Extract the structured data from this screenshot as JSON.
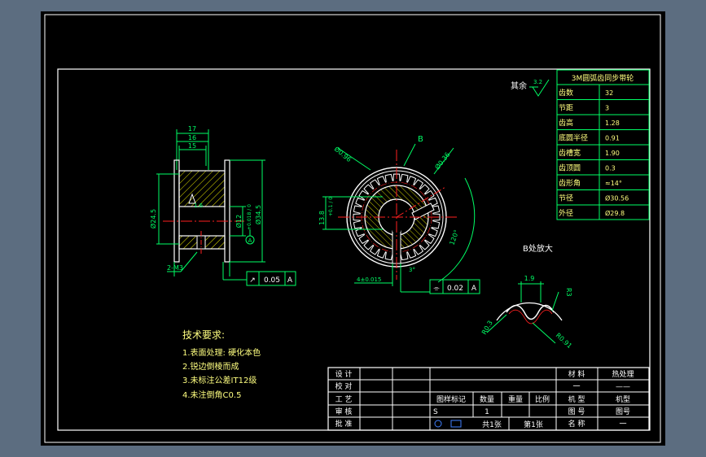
{
  "drawing": {
    "colors": {
      "background": "#000000",
      "frame": "#ffffff",
      "outline": "#ffffff",
      "dimension": "#00ff66",
      "centerline": "#ff2020",
      "hatch": "#ffff00",
      "text": "#ffffff",
      "text_yellow": "#ffff80",
      "table_border": "#00ff66",
      "table_text": "#ffff80"
    },
    "spec_table": {
      "title": "3M圆弧齿同步带轮",
      "rows": [
        {
          "label": "齿数",
          "value": "32"
        },
        {
          "label": "节距",
          "value": "3"
        },
        {
          "label": "齿高",
          "value": "1.28"
        },
        {
          "label": "底圆半径",
          "value": "0.91"
        },
        {
          "label": "齿槽宽",
          "value": "1.90"
        },
        {
          "label": "齿顶圆",
          "value": "0.3"
        },
        {
          "label": "齿形角",
          "value": "≈14°"
        },
        {
          "label": "节径",
          "value": "Ø30.56"
        },
        {
          "label": "外径",
          "value": "Ø29.8"
        }
      ]
    },
    "roughness": {
      "label": "其余",
      "value": "3.2"
    },
    "left_view": {
      "dims_top": [
        "17",
        "16",
        "15"
      ],
      "dims_left": "Ø24.5",
      "dims_right_1": "Ø12",
      "dims_right_1_tol": "+0.018 / 0",
      "dims_right_2": "Ø34.5",
      "inner_label": "1.6",
      "datum": "A",
      "bottom_dim": "2-M3",
      "tolerance_frame": {
        "symbol": "↗",
        "value": "0.05",
        "datum": "A"
      }
    },
    "front_view": {
      "label_b": "B",
      "dim_a": "Ø0.96",
      "dim_b": "Ø0.36",
      "dim_c": "13.8",
      "dim_c_tol": "+0.1 / 0",
      "dim_bottom": "4±0.015",
      "angle_1": "120°",
      "angle_2": "3°",
      "tolerance_frame": {
        "symbol": "⌯",
        "value": "0.02",
        "datum": "A"
      }
    },
    "detail_view": {
      "title": "B处放大",
      "dim_top": "1.9",
      "dim_right": "R3",
      "dim_left": "R0.3",
      "dim_bottom": "R0.91"
    },
    "tech_requirements": {
      "title": "技术要求:",
      "items": [
        "1.表面处理: 硬化本色",
        "2.锐边倒棱而成",
        "3.未标注公差IT12级",
        "4.未注倒角C0.5"
      ]
    },
    "title_block": {
      "left_labels": [
        "设 计",
        "校 对",
        "工 艺",
        "审 核",
        "批 准"
      ],
      "mid_headers": [
        "图样标记",
        "数量",
        "重量",
        "比例"
      ],
      "mid_values": [
        "S",
        "1"
      ],
      "sheets": [
        "共1张",
        "第1张"
      ],
      "right_headers": [
        "材 料",
        "热处理"
      ],
      "right_dashes": [
        "一",
        "——"
      ],
      "right_rows": [
        {
          "label": "机 型",
          "value": "机型"
        },
        {
          "label": "图 号",
          "value": "图号"
        },
        {
          "label": "名 称",
          "value": "一"
        }
      ]
    }
  }
}
